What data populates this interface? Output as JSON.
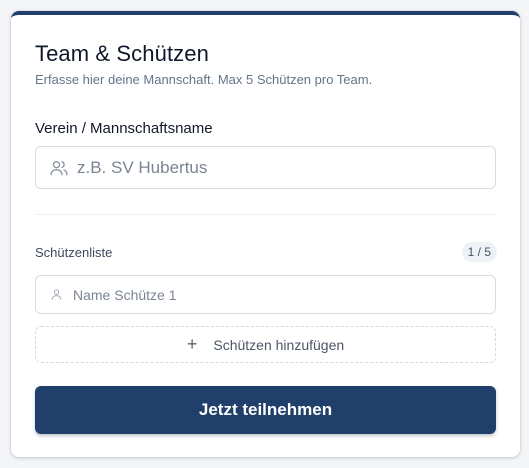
{
  "header": {
    "title": "Team & Schützen",
    "subtitle": "Erfasse hier deine Mannschaft. Max 5 Schützen pro Team."
  },
  "team": {
    "label": "Verein / Mannschaftsname",
    "placeholder": "z.B. SV Hubertus",
    "value": "",
    "icon": "users-icon"
  },
  "shooters": {
    "label": "Schützenliste",
    "count": "1 / 5",
    "items": [
      {
        "placeholder": "Name Schütze 1",
        "value": "",
        "icon": "user-icon"
      }
    ],
    "add_label": "Schützen hinzufügen",
    "add_icon": "plus-icon"
  },
  "submit": {
    "label": "Jetzt teilnehmen"
  },
  "colors": {
    "primary": "#213f6b",
    "muted_text": "#64748b",
    "border": "#d7dce3"
  }
}
